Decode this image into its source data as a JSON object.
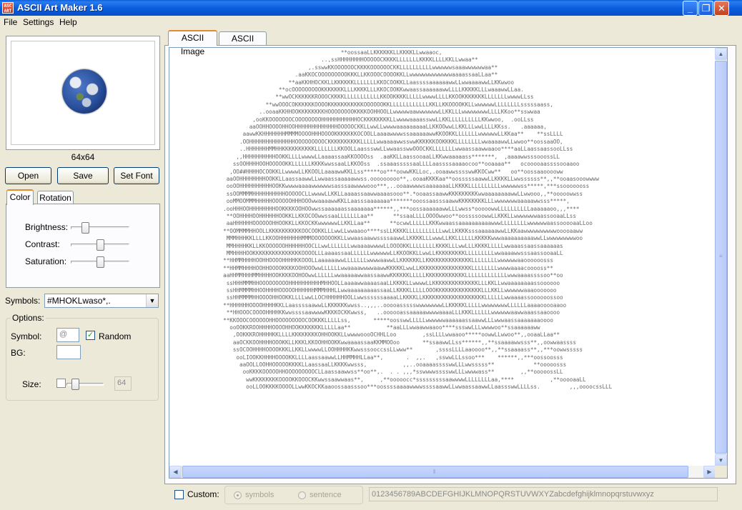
{
  "window": {
    "title": "ASCII Art Maker 1.6",
    "icon_text": "ASC\nART",
    "minimize": "_",
    "maximize": "❐",
    "close": "✕"
  },
  "menu": [
    "File",
    "Settings",
    "Help"
  ],
  "preview": {
    "size_label": "64x64"
  },
  "buttons": {
    "open": "Open",
    "save": "Save",
    "set_font": "Set Font"
  },
  "left_tabs": [
    {
      "label": "Color",
      "active": true
    },
    {
      "label": "Rotation",
      "active": false
    }
  ],
  "color_panel": {
    "brightness": {
      "label": "Brightness:",
      "value": 0.2
    },
    "contrast": {
      "label": "Contrast:",
      "value": 0.5
    },
    "saturation": {
      "label": "Saturation:",
      "value": 0.5
    }
  },
  "symbols": {
    "label": "Symbols:",
    "value": "#MHOKLwaso*,."
  },
  "options": {
    "title": "Options:",
    "symbol_label": "Symbol:",
    "symbol_value": "@",
    "random_label": "Random",
    "random_checked": true,
    "bg_label": "BG:",
    "size_label": "Size:",
    "size_value": "64",
    "size_slider": 0.15
  },
  "main_tabs": [
    {
      "label": "ASCII Image",
      "active": true
    },
    {
      "label": "ASCII Editor",
      "active": false
    }
  ],
  "ascii_lines": [
    "                                                    **oossaaLLKKKKKKLLKKKKLLwwaaoc,",
    "                                              ..,ssHHHHHHHHOOOOOCKKKKLLLLLLLKKKKLLLLKKLLwwaa**",
    "                                          ,.sswwKKOOOOOOCKKKKOOOOOOCKKLLLLLLLLLLwwwwwwsaaawwwwwwaa**",
    "                                      .aaKKOCOOOOOOOOOKKKLLKKOOOCOOOOKKLLwwwwwwwwwwwwwaaaassaaLLaa**",
    "                                    **aaKKHHOCKKLLKKKKKKLLLLLLLKKOCOOKKLLaassssaaaaaawwLLwwaaaawwLLKKwwoo",
    "                                 **ocOOOOOOOOOKKKKKKKLLLKKKKLLLKKOCOOKKwwaassaaaaaawwLLLLKKKKKLLLwaaawwLLaa.",
    "                                **wwOCKKKKKKROOOCKKKKLLLLLLLLLLLKKOOKKKKLLLLLwwwwLLLLKKOOKKKKKKKLLLLLLLwwwwLLss",
    "                             **wwOOOCOKKKKKKOOOOKKKKKKKKKKKOOOOOOKKLLLLLLLLLLLLKKLLKKOOOOKKLLwwwwwwLLLLLLLLsssssaass,",
    "                           ..ooaaKKHHOOKKKKKKKKHOOOOOOOOKKKKOOHHOOLLwwwwwaawwwwwwwLLKKLLLwwwwwwwwLLLLKKoo**sswwaa",
    "                         ,ooKKOOOOOOOCOOOOOOOOHHHHHHHHHHHOCKKKKKKKKLLwwwwaaaasswwLLKKLLLLLLLLLLKKwwoo,  .ooLLss",
    "                        aaOOHHOOOOHHOOHHHHHHHHHHHHHOOOOOCKKLLwwLLwwwwaaaaaaaaaLLKKOOwwLLKKLLLwwLLLLKKss.   .aaaaaa,",
    "                      aawwKKHHHHHHHMMMMOOOOHHHOOOOKKKKKKKOCOOLLaaaawwwwssaaaaaawwKKOOKKLLLLLLLwwwwwwLLKKaa**    **ssLLLL",
    "                     .OOHHHHHHHHHHHHHHOOOOOOOOOCKKKKKKKKKKLLLLLwwaaaawwsswwKKKKKKOOKKKKLLLLLLLLwwaaaawwLLwwoo**oossaaOO,",
    "                     ..HHHHHHHMMHHKKKKKKKKKKLLLLLLLKKOOLLaassswwLLwwaasswwOOOCKKLLLLLLLwwaassaawwaaoo****aaLLaassaassooLLss",
    "                    ,,HHHHHHHHHHOOKKLLLLwwwwLLaaaassaaKKOOOOss  .aaKKLLaassooaaLLKKwwaaaaass*******,  ,aaaawwsssooossLL",
    "                   ssOOHHHHOOHOOOOOKKLLLLLLKKKKwwssaaLLKKOOss  .ssaaasssssaaLLLLaassssaaaaocoo**ooaaaa**   ocooooaassssooaaoo",
    "                  ,OO##HHHHOCOOKKLLwwwwLLKKOOLLaaaawwKKLLss*****oo***oowwKKLLoc,.ooaawwsssswwKKOCww**   oo**oossaaooooww",
    "                 aaOOHHHHHHHHOOKKLLaassaawwLLwwaassaaaaawwss.ooooooooo**,.ooaaKKKKaa**oosssssaawwLLKKKKLLwwssssss**,,**ooaasooowwww",
    "                 ooOOHHHHHHHHHHOOKKwwwwaaaawwwwwwsasssaawwwwooo***,..ooaawwwwsaaaaaaaLLKKKKLLLLLLLLLLwwwwwwss*****,***ssooooooss",
    "                 ssOOMMMMHHHHHHHHHHOOOOOCLLwwwwLLKKLLaaaassaawwaaaasooo**.*ooaassaawwKKKKKKKKKwwaaaaaaaawwLLwwooo,,**ooooowwss",
    "                 ooMMOOMMMHHHHHOOOOOOHHHOOOwwaaaawwKKLLaasssaaaaaaa*******ooossaasssaawwKKKKKKKKLLLwwwwwwwaaaaawwsss*****,",
    "                .ooHHHOOHHHHHHHHOOKKKKOOHOOwwssaaaaaassaaaaaaa******,,***oossaaaaaawwLLLwwss*ooooowwLLLLLLLLLLaaaaaaoo,,,****",
    "                 **OOHHHHOOHHHHHHOOKKLLKKOCOOwwssaaLLLLLLLaa**      **ssaaLLLLOOOOwwoo**oossssoowwLLKKKLLwwwwwwwaassooaaLLss",
    "                 aaHHHHHHOOOOOOHHOOKKLLKKOCKKwwwwwwLLKKLLaa**      **ocwwLLLLLLKKKwwaassaaaaaaaaaawwwLLLLLLLLwwwwwwaassooooaaLLoo",
    "                **OOMMMMHHOOLLKKKKKKKKKKOOCOOKKLLLwwLLwwaaoo****ssLLKKKKLLLLLLLLLLLwwLLKKKKsssaaaaaawwLLKKaawwwwwwwwwwooooaaww",
    "                 MMMHHHKKLLLLKKOOHHHHHHHMMMOOOOOOOKKLLwwaasaawwssssaawwLLKKKKLLLwwwLLKKLLLLLLKKKKKwwwaaaaaaaaaawwLLwwwwwwwwwoo",
    "                 MMHHHHKKLLKKOOOOOOHHHHHHOOCLLwwLLLLLLLwwaaaawwwwLLOOOOKKLLLLLLLLKKKKLLLwwLLLKKKKLLLLLwwaaassaassaaaaaas",
    "                 MMHHHHOOKKKKKKKKKKKKKKKOOOOLLLaaaassaaLLLLLLwwwwwwLLKKOOKKLLwwLLKKKKKKKKKLLLLLLLLLwwaaaawwsssaassooaaLL",
    "                **HHMMHHHHOOHHOOOOHHHHKKOOOLLaaaaaawwLLLLLLLwwwwaawwLLKKKKKKLLKKKKKKKKKKKKKKLLLLLLLLwwwwwwaaoooooosss",
    "                **HHMMHHHHOOHHOOOOKKKKOOHOOOwwLLLLLLwwaaaawwwwaawwKKKKKLwwLLKKKKKKKKKKKKKKKKLLLLLLLLwwwwaaaacooooss**",
    "                aaHHMMHHHMMHHHHOOKKKKOOHOOwwLLLLLLwwaaaaawwaassaawwKKKKKKLLLLLKKKKKKKKKKKKLLLLLLLLLLLLLwwwaaaassssoo**oo",
    "                 ssHHHMMMHHOOOOOOOOOHHHHHHHHHHMHHOOLLaaaawwaaaasaaLLKKKKLLwwwwLLKKKKKKKKKKKKKKLLLKKLLwwaaaaaaaassoooooo",
    "                 ssHHMMMMHHOOHHHHOOOOOHHHHHHMMMHHHLLwwaaaaaaaaassaaLLKKKKLLLLLOOOKKKKKKKKKKKKKKLLLKKLLwwwwwwaaaooooooo",
    "                 ssHHMMMMHHOOOOHHOOKKLLLLwwLLOCHHHHHHOOLLwwssssssaaaaLLKKKKLLKKKKKKKKKKKKKKKKKKKLLLLLLwwaaaassoooooossoo",
    "                **HHHHHHOOOOHHHHKKLLaassssaawwLLKKKKKKwwss..,,,..ooooassssswwwwwwwwLLKKKKKLLLLLwwwwwwwwLLLLLLaaaaooooaaoo",
    "                 **HHOOOCOOOOHHHHKKwwssssaawwwwKKKKOCKKwwss,   ..oooooassaaaaawwwwaaaaLLLKKKLLLLLLwwwwwwaawwaaassaaoooo",
    "                **KKOOOCOOOOOOHHOOOOOOOOOCOOKKKLLLLLss,       *****oosswwLLLLLwwwwwwaaaaaassaawwLLLwwwaassaaaaaaaoooo",
    "                  ooOOKKROOHHHHOOOOHHOOKKKKKKKLLLLLaa**           **aaLLLwwaawwaaoo****ssswwLLLwwwwoo**ssaaaaaaww",
    "                   ,OOKKKROHHHHKKLLLLKKKKKKKKOHHOOKKLLwwwwoooOCHHLLoo        ,ssLLLLwwaaoo*****oowwLLwwoo**,,ooaaLLaa**",
    "                   aaOCKKOOHHHHOOOKKLLKKKLKKOOHHOOKKwwaaaassaaKKMMOOoo       **ssaawwLLss******,,**ssaaaawwsss**,,oowwaassss",
    "                   ssOCOOHHHHOOOOKKKLLKKLLwwwwLLOOHHHHKKwwsssooccssLLwww**       ,ssssLLLLaaoooo**,,**ssaaaass**,,***oowwsssss",
    "                    ooLIOOKKHHHHOOOOKKLLLLaassaawwLLHHMMHHLLaa**,       .  ,,.   ,sswwLLLssoo***    ******,,***oossoosss",
    "                     aaOOLLOOHHOOOOOKKKKLLaassaaLLKKKKwwsss,           ,,..ooaaaasssswwLLLwwsssss**            **ooooosss",
    "                      ooKKKKOOOOOHHOOOOOOOOOCLLaassaawwss**oo**,.  . . ,,,*sswwwwsssswwLLLwwwwass**        ,,**ooooossLL",
    "                       wwKKKKKKKKOOOOKKOOOCKKwwssaawwaas**,     ,**ooooocc*sssssssssaawwwwLLLLLLLLaa,****           ,**ooooaaLL",
    "                       ooLLOOKKKKOOOOLLwwKKOCKKaaoossaasssoo***oossssaaaawwwwssssaawwLLwwaassaawwLLaassswwLLLLss.         ,,,oooocssLLL"
  ],
  "custom": {
    "label": "Custom:",
    "checked": false,
    "mode_symbols": "symbols",
    "mode_sentence": "sentence",
    "mode_selected": "symbols",
    "charset": "0123456789ABCDEFGHIJKLMNOPQRSTUVWXYZabcdefghijklmnopqrstuvwxyz"
  }
}
